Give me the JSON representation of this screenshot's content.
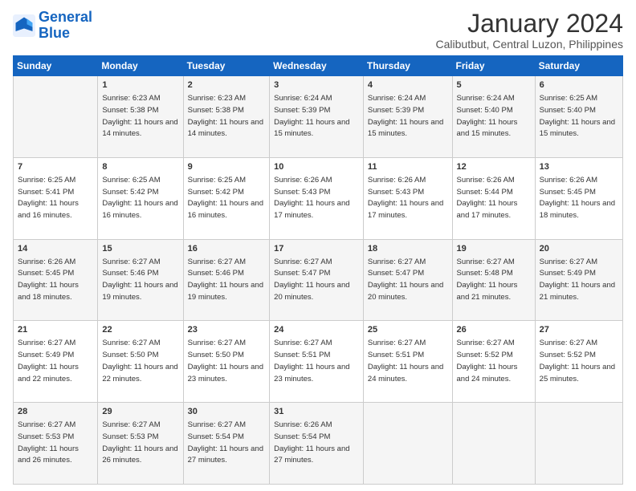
{
  "logo": {
    "line1": "General",
    "line2": "Blue"
  },
  "title": "January 2024",
  "subtitle": "Calibutbut, Central Luzon, Philippines",
  "days_header": [
    "Sunday",
    "Monday",
    "Tuesday",
    "Wednesday",
    "Thursday",
    "Friday",
    "Saturday"
  ],
  "weeks": [
    [
      {
        "num": "",
        "sunrise": "",
        "sunset": "",
        "daylight": ""
      },
      {
        "num": "1",
        "sunrise": "Sunrise: 6:23 AM",
        "sunset": "Sunset: 5:38 PM",
        "daylight": "Daylight: 11 hours and 14 minutes."
      },
      {
        "num": "2",
        "sunrise": "Sunrise: 6:23 AM",
        "sunset": "Sunset: 5:38 PM",
        "daylight": "Daylight: 11 hours and 14 minutes."
      },
      {
        "num": "3",
        "sunrise": "Sunrise: 6:24 AM",
        "sunset": "Sunset: 5:39 PM",
        "daylight": "Daylight: 11 hours and 15 minutes."
      },
      {
        "num": "4",
        "sunrise": "Sunrise: 6:24 AM",
        "sunset": "Sunset: 5:39 PM",
        "daylight": "Daylight: 11 hours and 15 minutes."
      },
      {
        "num": "5",
        "sunrise": "Sunrise: 6:24 AM",
        "sunset": "Sunset: 5:40 PM",
        "daylight": "Daylight: 11 hours and 15 minutes."
      },
      {
        "num": "6",
        "sunrise": "Sunrise: 6:25 AM",
        "sunset": "Sunset: 5:40 PM",
        "daylight": "Daylight: 11 hours and 15 minutes."
      }
    ],
    [
      {
        "num": "7",
        "sunrise": "Sunrise: 6:25 AM",
        "sunset": "Sunset: 5:41 PM",
        "daylight": "Daylight: 11 hours and 16 minutes."
      },
      {
        "num": "8",
        "sunrise": "Sunrise: 6:25 AM",
        "sunset": "Sunset: 5:42 PM",
        "daylight": "Daylight: 11 hours and 16 minutes."
      },
      {
        "num": "9",
        "sunrise": "Sunrise: 6:25 AM",
        "sunset": "Sunset: 5:42 PM",
        "daylight": "Daylight: 11 hours and 16 minutes."
      },
      {
        "num": "10",
        "sunrise": "Sunrise: 6:26 AM",
        "sunset": "Sunset: 5:43 PM",
        "daylight": "Daylight: 11 hours and 17 minutes."
      },
      {
        "num": "11",
        "sunrise": "Sunrise: 6:26 AM",
        "sunset": "Sunset: 5:43 PM",
        "daylight": "Daylight: 11 hours and 17 minutes."
      },
      {
        "num": "12",
        "sunrise": "Sunrise: 6:26 AM",
        "sunset": "Sunset: 5:44 PM",
        "daylight": "Daylight: 11 hours and 17 minutes."
      },
      {
        "num": "13",
        "sunrise": "Sunrise: 6:26 AM",
        "sunset": "Sunset: 5:45 PM",
        "daylight": "Daylight: 11 hours and 18 minutes."
      }
    ],
    [
      {
        "num": "14",
        "sunrise": "Sunrise: 6:26 AM",
        "sunset": "Sunset: 5:45 PM",
        "daylight": "Daylight: 11 hours and 18 minutes."
      },
      {
        "num": "15",
        "sunrise": "Sunrise: 6:27 AM",
        "sunset": "Sunset: 5:46 PM",
        "daylight": "Daylight: 11 hours and 19 minutes."
      },
      {
        "num": "16",
        "sunrise": "Sunrise: 6:27 AM",
        "sunset": "Sunset: 5:46 PM",
        "daylight": "Daylight: 11 hours and 19 minutes."
      },
      {
        "num": "17",
        "sunrise": "Sunrise: 6:27 AM",
        "sunset": "Sunset: 5:47 PM",
        "daylight": "Daylight: 11 hours and 20 minutes."
      },
      {
        "num": "18",
        "sunrise": "Sunrise: 6:27 AM",
        "sunset": "Sunset: 5:47 PM",
        "daylight": "Daylight: 11 hours and 20 minutes."
      },
      {
        "num": "19",
        "sunrise": "Sunrise: 6:27 AM",
        "sunset": "Sunset: 5:48 PM",
        "daylight": "Daylight: 11 hours and 21 minutes."
      },
      {
        "num": "20",
        "sunrise": "Sunrise: 6:27 AM",
        "sunset": "Sunset: 5:49 PM",
        "daylight": "Daylight: 11 hours and 21 minutes."
      }
    ],
    [
      {
        "num": "21",
        "sunrise": "Sunrise: 6:27 AM",
        "sunset": "Sunset: 5:49 PM",
        "daylight": "Daylight: 11 hours and 22 minutes."
      },
      {
        "num": "22",
        "sunrise": "Sunrise: 6:27 AM",
        "sunset": "Sunset: 5:50 PM",
        "daylight": "Daylight: 11 hours and 22 minutes."
      },
      {
        "num": "23",
        "sunrise": "Sunrise: 6:27 AM",
        "sunset": "Sunset: 5:50 PM",
        "daylight": "Daylight: 11 hours and 23 minutes."
      },
      {
        "num": "24",
        "sunrise": "Sunrise: 6:27 AM",
        "sunset": "Sunset: 5:51 PM",
        "daylight": "Daylight: 11 hours and 23 minutes."
      },
      {
        "num": "25",
        "sunrise": "Sunrise: 6:27 AM",
        "sunset": "Sunset: 5:51 PM",
        "daylight": "Daylight: 11 hours and 24 minutes."
      },
      {
        "num": "26",
        "sunrise": "Sunrise: 6:27 AM",
        "sunset": "Sunset: 5:52 PM",
        "daylight": "Daylight: 11 hours and 24 minutes."
      },
      {
        "num": "27",
        "sunrise": "Sunrise: 6:27 AM",
        "sunset": "Sunset: 5:52 PM",
        "daylight": "Daylight: 11 hours and 25 minutes."
      }
    ],
    [
      {
        "num": "28",
        "sunrise": "Sunrise: 6:27 AM",
        "sunset": "Sunset: 5:53 PM",
        "daylight": "Daylight: 11 hours and 26 minutes."
      },
      {
        "num": "29",
        "sunrise": "Sunrise: 6:27 AM",
        "sunset": "Sunset: 5:53 PM",
        "daylight": "Daylight: 11 hours and 26 minutes."
      },
      {
        "num": "30",
        "sunrise": "Sunrise: 6:27 AM",
        "sunset": "Sunset: 5:54 PM",
        "daylight": "Daylight: 11 hours and 27 minutes."
      },
      {
        "num": "31",
        "sunrise": "Sunrise: 6:26 AM",
        "sunset": "Sunset: 5:54 PM",
        "daylight": "Daylight: 11 hours and 27 minutes."
      },
      {
        "num": "",
        "sunrise": "",
        "sunset": "",
        "daylight": ""
      },
      {
        "num": "",
        "sunrise": "",
        "sunset": "",
        "daylight": ""
      },
      {
        "num": "",
        "sunrise": "",
        "sunset": "",
        "daylight": ""
      }
    ]
  ]
}
